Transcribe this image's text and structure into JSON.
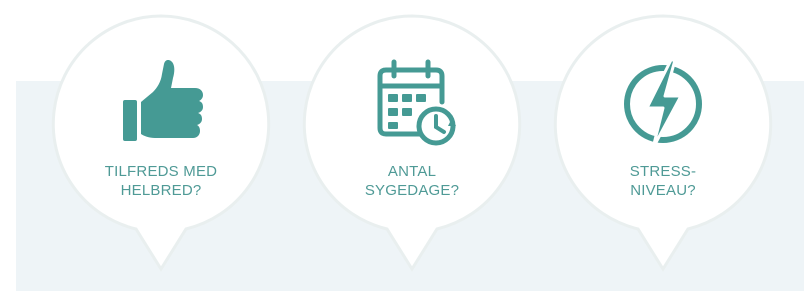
{
  "colors": {
    "accent": "#459a94",
    "panel": "#eef4f7",
    "bubble_border": "#e9efef",
    "bubble_fill": "#ffffff"
  },
  "bubbles": [
    {
      "icon": "thumbs-up-icon",
      "label_line1": "TILFREDS MED",
      "label_line2": "HELBRED?"
    },
    {
      "icon": "calendar-clock-icon",
      "label_line1": "ANTAL",
      "label_line2": "SYGEDAGE?"
    },
    {
      "icon": "lightning-bolt-icon",
      "label_line1": "STRESS-",
      "label_line2": "NIVEAU?"
    }
  ]
}
